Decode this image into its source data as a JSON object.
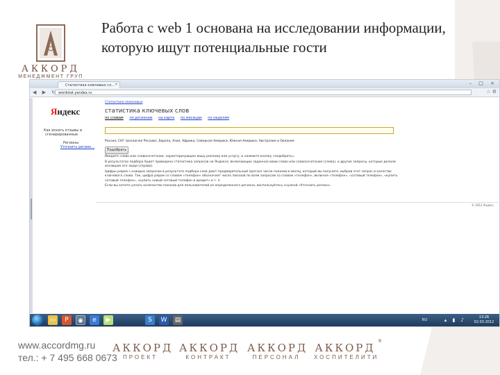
{
  "slide": {
    "title": "Работа с web 1 основана на исследовании информации, которую ищут потенциальные гости"
  },
  "logo": {
    "name": "АККОРД",
    "subtitle": "МЕНЕДЖМЕНТ ГРУП"
  },
  "browser": {
    "tab_title": "Статистика ключевых сл...",
    "url": "wordstat.yandex.ru",
    "window_controls": "– □ ×"
  },
  "yandex": {
    "logo_first": "Я",
    "logo_rest": "ндекс",
    "top_link": "Статистика поисковых",
    "service_title": "статистика ключевых слов",
    "tabs": [
      "по словам",
      "по регионам",
      "на карте",
      "по месяцам",
      "по неделям"
    ],
    "sidebar_text_1": "Как искать отзывы и",
    "sidebar_text_2": "сгенерированные",
    "sidebar_regions_label": "Регионы",
    "sidebar_regions_link": "Уточнить регион...",
    "search_value": "",
    "regions_line": "Россия, СНГ (исключая Россию), Европа, Азия, Африка, Северная Америка, Южная Америка, Австралия и Океания",
    "pick_button": "Подобрать",
    "paragraphs": [
      "Введите слово или словосочетание, характеризующее вашу рекламу или услугу, и нажмите кнопку «подобрать».",
      "В результатах подбора будет приведена статистика запросов на Яндексе, включающих заданное вами слово или словосочетание (слева), и другие запросы, которые делали искавшие его люди (справа).",
      "Цифры рядом с каждым запросом в результате подбора слов дают предварительный прогноз числа показов в месяц, который вы получите, выбрав этот запрос в качестве ключевого слова. Так, цифра рядом со словом «телефон» обозначает число показов по всем запросам со словом «телефон», включая «телефон», «сотовый телефон», «купить сотовый телефон», «купить новый сотовый телефон в кредит» и т. п.",
      "Если вы хотите узнать количество показов для пользователей из определенного региона, воспользуйтесь ссылкой «Уточнить регион»."
    ],
    "copyright": "© 2012 Яндекс"
  },
  "taskbar": {
    "lang": "RU",
    "time": "13:26",
    "date": "02.03.2012"
  },
  "footer": {
    "site": "www.accordmg.ru",
    "phone": "тел.: + 7 495 668 0673",
    "brands": [
      {
        "name": "АККОРД",
        "sub": "ПРОЕКТ"
      },
      {
        "name": "АККОРД",
        "sub": "КОНТРАКТ"
      },
      {
        "name": "АККОРД",
        "sub": "ПЕРСОНАЛ"
      },
      {
        "name": "АККОРД",
        "sub": "ХОСПИТЕЛИТИ"
      }
    ],
    "registered_mark": "®"
  },
  "colors": {
    "brand_brown": "#7a5a49",
    "taskbar_blue": "#1f3b5e",
    "link_blue": "#1a3dc1",
    "yandex_red": "#e61400"
  }
}
